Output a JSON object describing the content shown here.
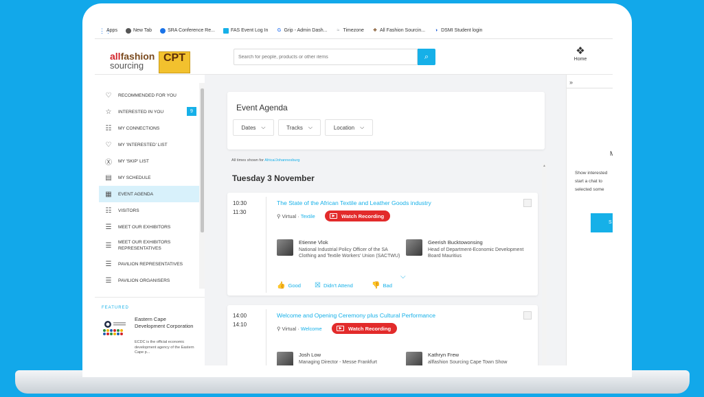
{
  "bookmarks": [
    {
      "label": "Apps",
      "icon": "apps-grid-icon",
      "color": "#1a73e8"
    },
    {
      "label": "New Tab",
      "icon": "globe-icon",
      "color": "#555555"
    },
    {
      "label": "SRA Conference Re...",
      "icon": "sra-icon",
      "color": "#1a73e8"
    },
    {
      "label": "FAS Event Log In",
      "icon": "fas-icon",
      "color": "#16b0e8"
    },
    {
      "label": "Grip - Admin Dash...",
      "icon": "google-icon",
      "color": "#4285f4"
    },
    {
      "label": "Timezone",
      "icon": "timezone-icon",
      "color": "#9aa0a6"
    },
    {
      "label": "All Fashion Sourcin...",
      "icon": "allfashion-icon",
      "color": "#7a4a1e"
    },
    {
      "label": "DSMI Student login",
      "icon": "dsmi-icon",
      "color": "#1a5bd8"
    }
  ],
  "header": {
    "logo_line1_a": "all",
    "logo_line1_b": "fashion",
    "logo_line2": "sourcing",
    "cpt_label": "CPT",
    "search_placeholder": "Search for people, products or other items",
    "home_label": "Home"
  },
  "sidebar": {
    "items": [
      {
        "label": "Recommended for you",
        "icon": "recommend-icon"
      },
      {
        "label": "Interested in you",
        "icon": "star-icon",
        "badge": "9"
      },
      {
        "label": "My connections",
        "icon": "connections-icon"
      },
      {
        "label": "My 'Interested' list",
        "icon": "heart-list-icon"
      },
      {
        "label": "My 'Skip' list",
        "icon": "skip-icon"
      },
      {
        "label": "My schedule",
        "icon": "schedule-icon"
      },
      {
        "label": "Event agenda",
        "icon": "calendar-icon",
        "active": true
      },
      {
        "label": "Visitors",
        "icon": "visitors-icon"
      },
      {
        "label": "Meet our exhibitors",
        "icon": "list-icon"
      },
      {
        "label": "Meet our exhibitors representatives",
        "icon": "list-icon"
      },
      {
        "label": "Pavilion representatives",
        "icon": "list-icon"
      },
      {
        "label": "Pavilion organisers",
        "icon": "list-icon"
      }
    ],
    "featured_title": "FEATURED",
    "featured_name": "Eastern Cape Development Corporation",
    "featured_desc": "ECDC is the official economic development agency of the Eastern Cape p..."
  },
  "agenda": {
    "title": "Event Agenda",
    "filters": [
      "Dates",
      "Tracks",
      "Location"
    ],
    "timezone_prefix": "All times shown for",
    "timezone_link": "Africa/Johannesburg",
    "day_title": "Tuesday 3 November"
  },
  "sessions": [
    {
      "start": "10:30",
      "end": "11:30",
      "title": "The State of the African Textile and Leather Goods industry",
      "location": "Virtual",
      "track": "Textile",
      "watch_label": "Watch Recording",
      "speakers": [
        {
          "name": "Etienne Vlok",
          "role": "National Industrial Policy Officer of the SA Clothing and Textile Workers' Union (SACTWU)"
        },
        {
          "name": "Geerish Bucktowonsing",
          "role": "Head of Department-Economic Development Board Mauritius"
        }
      ],
      "feedback": [
        "Good",
        "Didn't Attend",
        "Bad"
      ]
    },
    {
      "start": "14:00",
      "end": "14:10",
      "title": "Welcome and Opening Ceremony plus Cultural Performance",
      "location": "Virtual",
      "track": "Welcome",
      "watch_label": "Watch Recording",
      "speakers": [
        {
          "name": "Josh Low",
          "role": "Managing Director - Messe Frankfurt"
        },
        {
          "name": "Kathryn Frew",
          "role": "allfashion Sourcing Cape Town Show"
        }
      ]
    }
  ],
  "right_panel": {
    "collapse": "»",
    "letter": "M",
    "text_lines": [
      "Show interested",
      "start a chat to",
      "selected some"
    ],
    "button": "S"
  },
  "colors": {
    "accent": "#16b0e8",
    "watch": "#e22b2b",
    "background": "#12a8ea"
  }
}
